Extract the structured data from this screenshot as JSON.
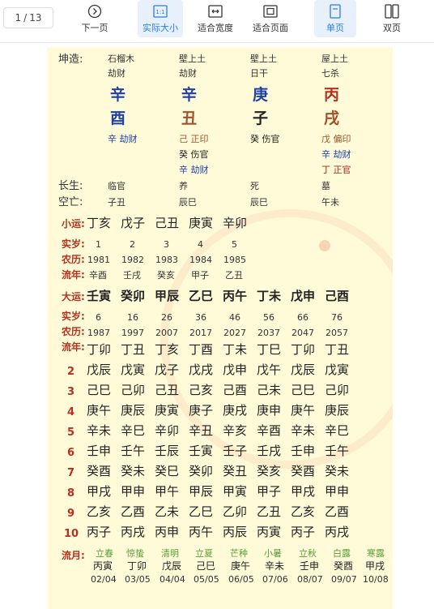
{
  "toolbar": {
    "page_current": "1",
    "page_sep": "/",
    "page_total": "13",
    "buttons": [
      {
        "label": "下一页",
        "icon": "next-page-icon"
      },
      {
        "label": "实际大小",
        "icon": "actual-size-icon"
      },
      {
        "label": "适合宽度",
        "icon": "fit-width-icon"
      },
      {
        "label": "适合页面",
        "icon": "fit-page-icon"
      },
      {
        "label": "单页",
        "icon": "single-page-icon"
      },
      {
        "label": "双页",
        "icon": "double-page-icon"
      }
    ],
    "accent_color": "#2a7de1"
  },
  "chart": {
    "title": "坤造:",
    "nayin": [
      "石榴木",
      "壁上土",
      "壁上土",
      "屋上土"
    ],
    "shishen_top": [
      "劫财",
      "劫财",
      "日干",
      "七杀"
    ],
    "tiangan": [
      "辛",
      "辛",
      "庚",
      "丙"
    ],
    "dizhi": [
      "酉",
      "丑",
      "子",
      "戌"
    ],
    "canggan": [
      [
        "辛 劫财"
      ],
      [
        "己 正印",
        "癸 伤官",
        "辛 劫财"
      ],
      [
        "癸 伤官"
      ],
      [
        "戊 偏印",
        "辛 劫财",
        "丁 正官"
      ]
    ],
    "changsheng_label": "长生:",
    "changsheng": [
      "临官",
      "养",
      "死",
      "墓"
    ],
    "kongwang_label": "空亡:",
    "kongwang": [
      "子丑",
      "辰巳",
      "辰巳",
      "午未"
    ]
  },
  "xiaoyun": {
    "label": "小运:",
    "ganzhi": [
      "丁亥",
      "戊子",
      "己丑",
      "庚寅",
      "辛卯"
    ],
    "age_label": "实岁:",
    "ages": [
      "1",
      "2",
      "3",
      "4",
      "5"
    ],
    "year_label": "农历:",
    "years": [
      "1981",
      "1982",
      "1983",
      "1984",
      "1985"
    ],
    "liunian_label": "流年:",
    "liunian": [
      "辛酉",
      "壬戌",
      "癸亥",
      "甲子",
      "乙丑"
    ]
  },
  "dayun": {
    "label": "大运:",
    "ganzhi": [
      "壬寅",
      "癸卯",
      "甲辰",
      "乙巳",
      "丙午",
      "丁未",
      "戊申",
      "己酉"
    ],
    "age_label": "实岁:",
    "ages": [
      "6",
      "16",
      "26",
      "36",
      "46",
      "56",
      "66",
      "76"
    ],
    "year_label": "农历:",
    "years": [
      "1987",
      "1997",
      "2007",
      "2017",
      "2027",
      "2037",
      "2047",
      "2057"
    ],
    "liunian_label": "流年:",
    "rows": [
      {
        "n": "",
        "vals": [
          "丁卯",
          "丁丑",
          "丁亥",
          "丁酉",
          "丁未",
          "丁巳",
          "丁卯",
          "丁丑"
        ]
      },
      {
        "n": "2",
        "vals": [
          "戊辰",
          "戊寅",
          "戊子",
          "戊戌",
          "戊申",
          "戊午",
          "戊辰",
          "戊寅"
        ]
      },
      {
        "n": "3",
        "vals": [
          "己巳",
          "己卯",
          "己丑",
          "己亥",
          "己酉",
          "己未",
          "己巳",
          "己卯"
        ]
      },
      {
        "n": "4",
        "vals": [
          "庚午",
          "庚辰",
          "庚寅",
          "庚子",
          "庚戌",
          "庚申",
          "庚午",
          "庚辰"
        ]
      },
      {
        "n": "5",
        "vals": [
          "辛未",
          "辛巳",
          "辛卯",
          "辛丑",
          "辛亥",
          "辛酉",
          "辛未",
          "辛巳"
        ]
      },
      {
        "n": "6",
        "vals": [
          "壬申",
          "壬午",
          "壬辰",
          "壬寅",
          "壬子",
          "壬戌",
          "壬申",
          "壬午"
        ]
      },
      {
        "n": "7",
        "vals": [
          "癸酉",
          "癸未",
          "癸巳",
          "癸卯",
          "癸丑",
          "癸亥",
          "癸酉",
          "癸未"
        ]
      },
      {
        "n": "8",
        "vals": [
          "甲戌",
          "甲申",
          "甲午",
          "甲辰",
          "甲寅",
          "甲子",
          "甲戌",
          "甲申"
        ]
      },
      {
        "n": "9",
        "vals": [
          "乙亥",
          "乙酉",
          "乙未",
          "乙巳",
          "乙卯",
          "乙丑",
          "乙亥",
          "乙酉"
        ]
      },
      {
        "n": "10",
        "vals": [
          "丙子",
          "丙戌",
          "丙申",
          "丙午",
          "丙辰",
          "丙寅",
          "丙子",
          "丙戌"
        ]
      }
    ]
  },
  "liuyue": {
    "label": "流月:",
    "terms": [
      "立春",
      "惊蛰",
      "清明",
      "立夏",
      "芒种",
      "小暑",
      "立秋",
      "白露",
      "寒露"
    ],
    "ganzhi": [
      "丙寅",
      "丁卯",
      "戊辰",
      "己巳",
      "庚午",
      "辛未",
      "壬申",
      "癸酉",
      "甲戌"
    ],
    "dates": [
      "02/04",
      "03/05",
      "04/04",
      "05/05",
      "06/05",
      "07/06",
      "08/07",
      "09/07",
      "10/08"
    ]
  }
}
